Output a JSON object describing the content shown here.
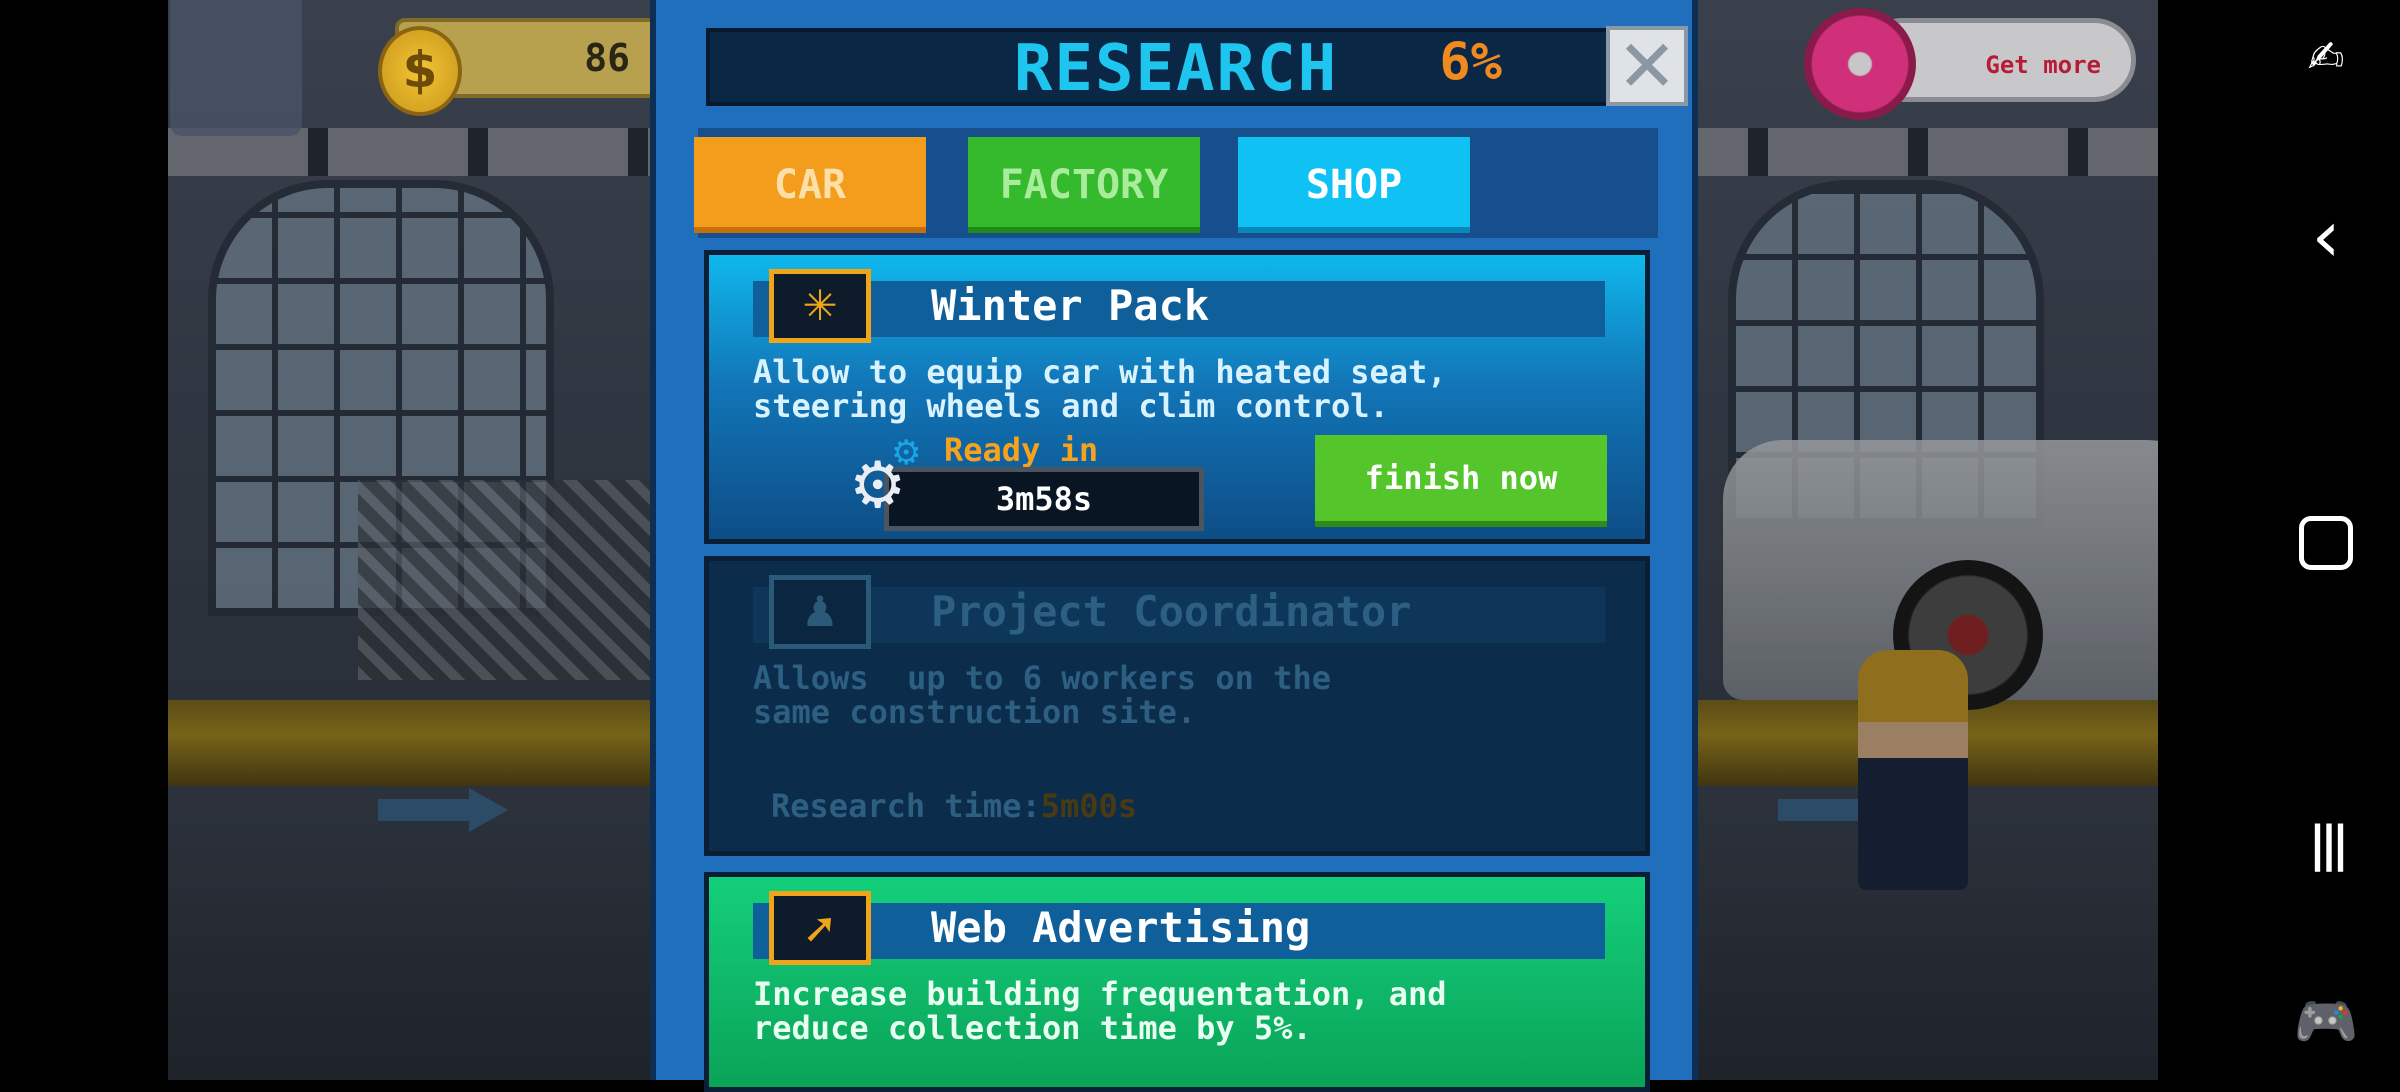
{
  "hud": {
    "coins": "86",
    "coin_symbol": "$",
    "get_more": "Get more"
  },
  "research": {
    "title": "RESEARCH",
    "percent": "6%",
    "close_symbol": "✕",
    "tabs": [
      {
        "label": "CAR",
        "color": "#f49c1b"
      },
      {
        "label": "FACTORY",
        "color": "#35ba2e"
      },
      {
        "label": "SHOP",
        "color": "#0fc2f3",
        "selected": true
      }
    ],
    "items": [
      {
        "icon": "snowflake-icon",
        "title": "Winter Pack",
        "description": "Allow to equip car with heated seat,\nsteering wheels and clim control.",
        "status": "in-progress",
        "ready_label": "Ready in",
        "timer": "3m58s",
        "finish_label": "finish now"
      },
      {
        "icon": "worker-icon",
        "title": "Project Coordinator",
        "description": "Allows  up to 6 workers on the\nsame construction site.",
        "status": "locked",
        "research_time_label": "Research time:",
        "research_time_value": "5m00s"
      },
      {
        "icon": "web-cursor-icon",
        "title": "Web Advertising",
        "description": "Increase building frequentation, and\nreduce collection time by 5%.",
        "status": "available"
      }
    ]
  },
  "nav": {
    "back": "‹",
    "recents": "|||",
    "accent": "#ffffff"
  }
}
